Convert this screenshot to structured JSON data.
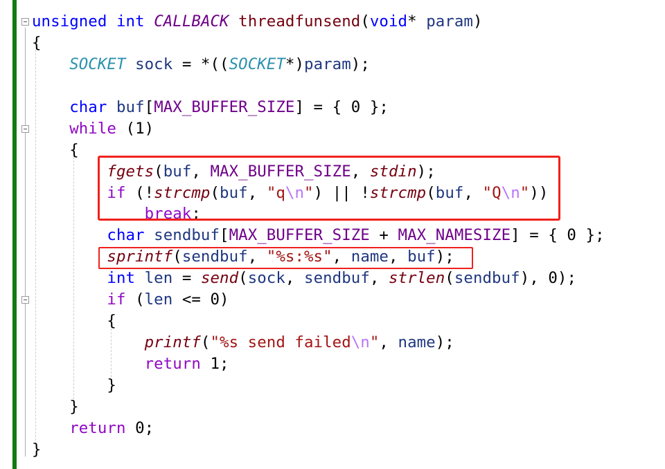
{
  "editor": {
    "accent_colors": {
      "change_bar": "#107c10",
      "highlight_box": "#f0201c"
    },
    "lines": [
      [
        [
          "kw",
          "unsigned"
        ],
        [
          "p",
          " "
        ],
        [
          "kw",
          "int"
        ],
        [
          "p",
          " "
        ],
        [
          "cc",
          "CALLBACK"
        ],
        [
          "p",
          " "
        ],
        [
          "fnm",
          "threadfunsend"
        ],
        [
          "p",
          "("
        ],
        [
          "kw",
          "void"
        ],
        [
          "p",
          "* "
        ],
        [
          "id",
          "param"
        ],
        [
          "p",
          ")"
        ]
      ],
      [
        [
          "p",
          "{"
        ]
      ],
      [
        [
          "p",
          "    "
        ],
        [
          "type",
          "SOCKET"
        ],
        [
          "p",
          " "
        ],
        [
          "id",
          "sock"
        ],
        [
          "p",
          " = *(("
        ],
        [
          "type",
          "SOCKET"
        ],
        [
          "p",
          "*)"
        ],
        [
          "id",
          "param"
        ],
        [
          "p",
          ");"
        ]
      ],
      [],
      [
        [
          "p",
          "    "
        ],
        [
          "kw",
          "char"
        ],
        [
          "p",
          " "
        ],
        [
          "id",
          "buf"
        ],
        [
          "p",
          "["
        ],
        [
          "mac",
          "MAX_BUFFER_SIZE"
        ],
        [
          "p",
          "] = { 0 };"
        ]
      ],
      [
        [
          "p",
          "    "
        ],
        [
          "ctl",
          "while"
        ],
        [
          "p",
          " (1)"
        ]
      ],
      [
        [
          "p",
          "    {"
        ]
      ],
      [
        [
          "p",
          "        "
        ],
        [
          "fn",
          "fgets"
        ],
        [
          "p",
          "("
        ],
        [
          "id",
          "buf"
        ],
        [
          "p",
          ", "
        ],
        [
          "mac",
          "MAX_BUFFER_SIZE"
        ],
        [
          "p",
          ", "
        ],
        [
          "fn",
          "stdin"
        ],
        [
          "p",
          ");"
        ]
      ],
      [
        [
          "p",
          "        "
        ],
        [
          "ctl",
          "if"
        ],
        [
          "p",
          " (!"
        ],
        [
          "fn",
          "strcmp"
        ],
        [
          "p",
          "("
        ],
        [
          "id",
          "buf"
        ],
        [
          "p",
          ", "
        ],
        [
          "str",
          "\"q"
        ],
        [
          "esc",
          "\\n"
        ],
        [
          "str",
          "\""
        ],
        [
          "p",
          ") || !"
        ],
        [
          "fn",
          "strcmp"
        ],
        [
          "p",
          "("
        ],
        [
          "id",
          "buf"
        ],
        [
          "p",
          ", "
        ],
        [
          "str",
          "\"Q"
        ],
        [
          "esc",
          "\\n"
        ],
        [
          "str",
          "\""
        ],
        [
          "p",
          "))"
        ]
      ],
      [
        [
          "p",
          "            "
        ],
        [
          "ctl",
          "break"
        ],
        [
          "p",
          ";"
        ]
      ],
      [
        [
          "p",
          "        "
        ],
        [
          "kw",
          "char"
        ],
        [
          "p",
          " "
        ],
        [
          "id",
          "sendbuf"
        ],
        [
          "p",
          "["
        ],
        [
          "mac",
          "MAX_BUFFER_SIZE"
        ],
        [
          "p",
          " + "
        ],
        [
          "mac",
          "MAX_NAMESIZE"
        ],
        [
          "p",
          "] = { 0 };"
        ]
      ],
      [
        [
          "p",
          "        "
        ],
        [
          "fn",
          "sprintf"
        ],
        [
          "p",
          "("
        ],
        [
          "id",
          "sendbuf"
        ],
        [
          "p",
          ", "
        ],
        [
          "str",
          "\"%s:%s\""
        ],
        [
          "p",
          ", "
        ],
        [
          "id",
          "name"
        ],
        [
          "p",
          ", "
        ],
        [
          "id",
          "buf"
        ],
        [
          "p",
          ");"
        ]
      ],
      [
        [
          "p",
          "        "
        ],
        [
          "kw",
          "int"
        ],
        [
          "p",
          " "
        ],
        [
          "id",
          "len"
        ],
        [
          "p",
          " = "
        ],
        [
          "fn",
          "send"
        ],
        [
          "p",
          "("
        ],
        [
          "id",
          "sock"
        ],
        [
          "p",
          ", "
        ],
        [
          "id",
          "sendbuf"
        ],
        [
          "p",
          ", "
        ],
        [
          "fn",
          "strlen"
        ],
        [
          "p",
          "("
        ],
        [
          "id",
          "sendbuf"
        ],
        [
          "p",
          "), 0);"
        ]
      ],
      [
        [
          "p",
          "        "
        ],
        [
          "ctl",
          "if"
        ],
        [
          "p",
          " ("
        ],
        [
          "id",
          "len"
        ],
        [
          "p",
          " <= 0)"
        ]
      ],
      [
        [
          "p",
          "        {"
        ]
      ],
      [
        [
          "p",
          "            "
        ],
        [
          "fn",
          "printf"
        ],
        [
          "p",
          "("
        ],
        [
          "str",
          "\"%s send failed"
        ],
        [
          "esc",
          "\\n"
        ],
        [
          "str",
          "\""
        ],
        [
          "p",
          ", "
        ],
        [
          "id",
          "name"
        ],
        [
          "p",
          ");"
        ]
      ],
      [
        [
          "p",
          "            "
        ],
        [
          "ctl",
          "return"
        ],
        [
          "p",
          " 1;"
        ]
      ],
      [
        [
          "p",
          "        }"
        ]
      ],
      [
        [
          "p",
          "    }"
        ]
      ],
      [
        [
          "p",
          "    "
        ],
        [
          "ctl",
          "return"
        ],
        [
          "p",
          " 0;"
        ]
      ],
      [
        [
          "p",
          "}"
        ]
      ]
    ]
  }
}
